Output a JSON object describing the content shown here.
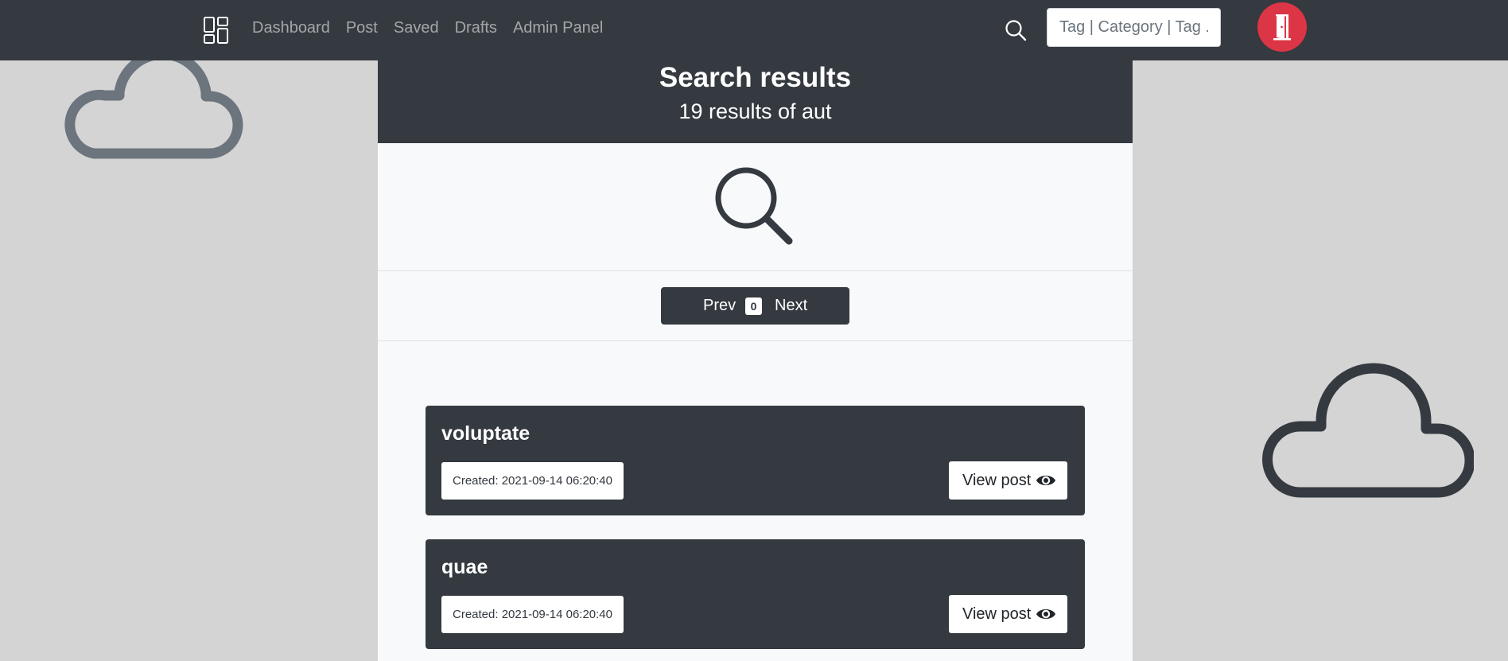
{
  "navbar": {
    "brand_icon": "grid-layout-icon",
    "links": [
      "Dashboard",
      "Post",
      "Saved",
      "Drafts",
      "Admin Panel"
    ],
    "search_icon": "search-icon",
    "search_placeholder": "Tag | Category | Tag ...",
    "logout_icon": "door-exit-icon",
    "logout_color": "#dc3545"
  },
  "header": {
    "title": "Search results",
    "subtitle": "19 results of aut"
  },
  "hero_icon": "search-icon",
  "pagination": {
    "prev_label": "Prev",
    "current_page": "0",
    "next_label": "Next"
  },
  "posts": [
    {
      "title": "voluptate",
      "created": "Created: 2021-09-14 06:20:40",
      "view_label": "View post"
    },
    {
      "title": "quae",
      "created": "Created: 2021-09-14 06:20:40",
      "view_label": "View post"
    }
  ],
  "colors": {
    "dark": "#343a40",
    "page_bg": "#d4d4d4",
    "content_bg": "#f8f9fa",
    "danger": "#dc3545",
    "cloud_left": "#6c757d",
    "cloud_right": "#343a40"
  },
  "decor": [
    "cloud-icon",
    "cloud-icon"
  ]
}
